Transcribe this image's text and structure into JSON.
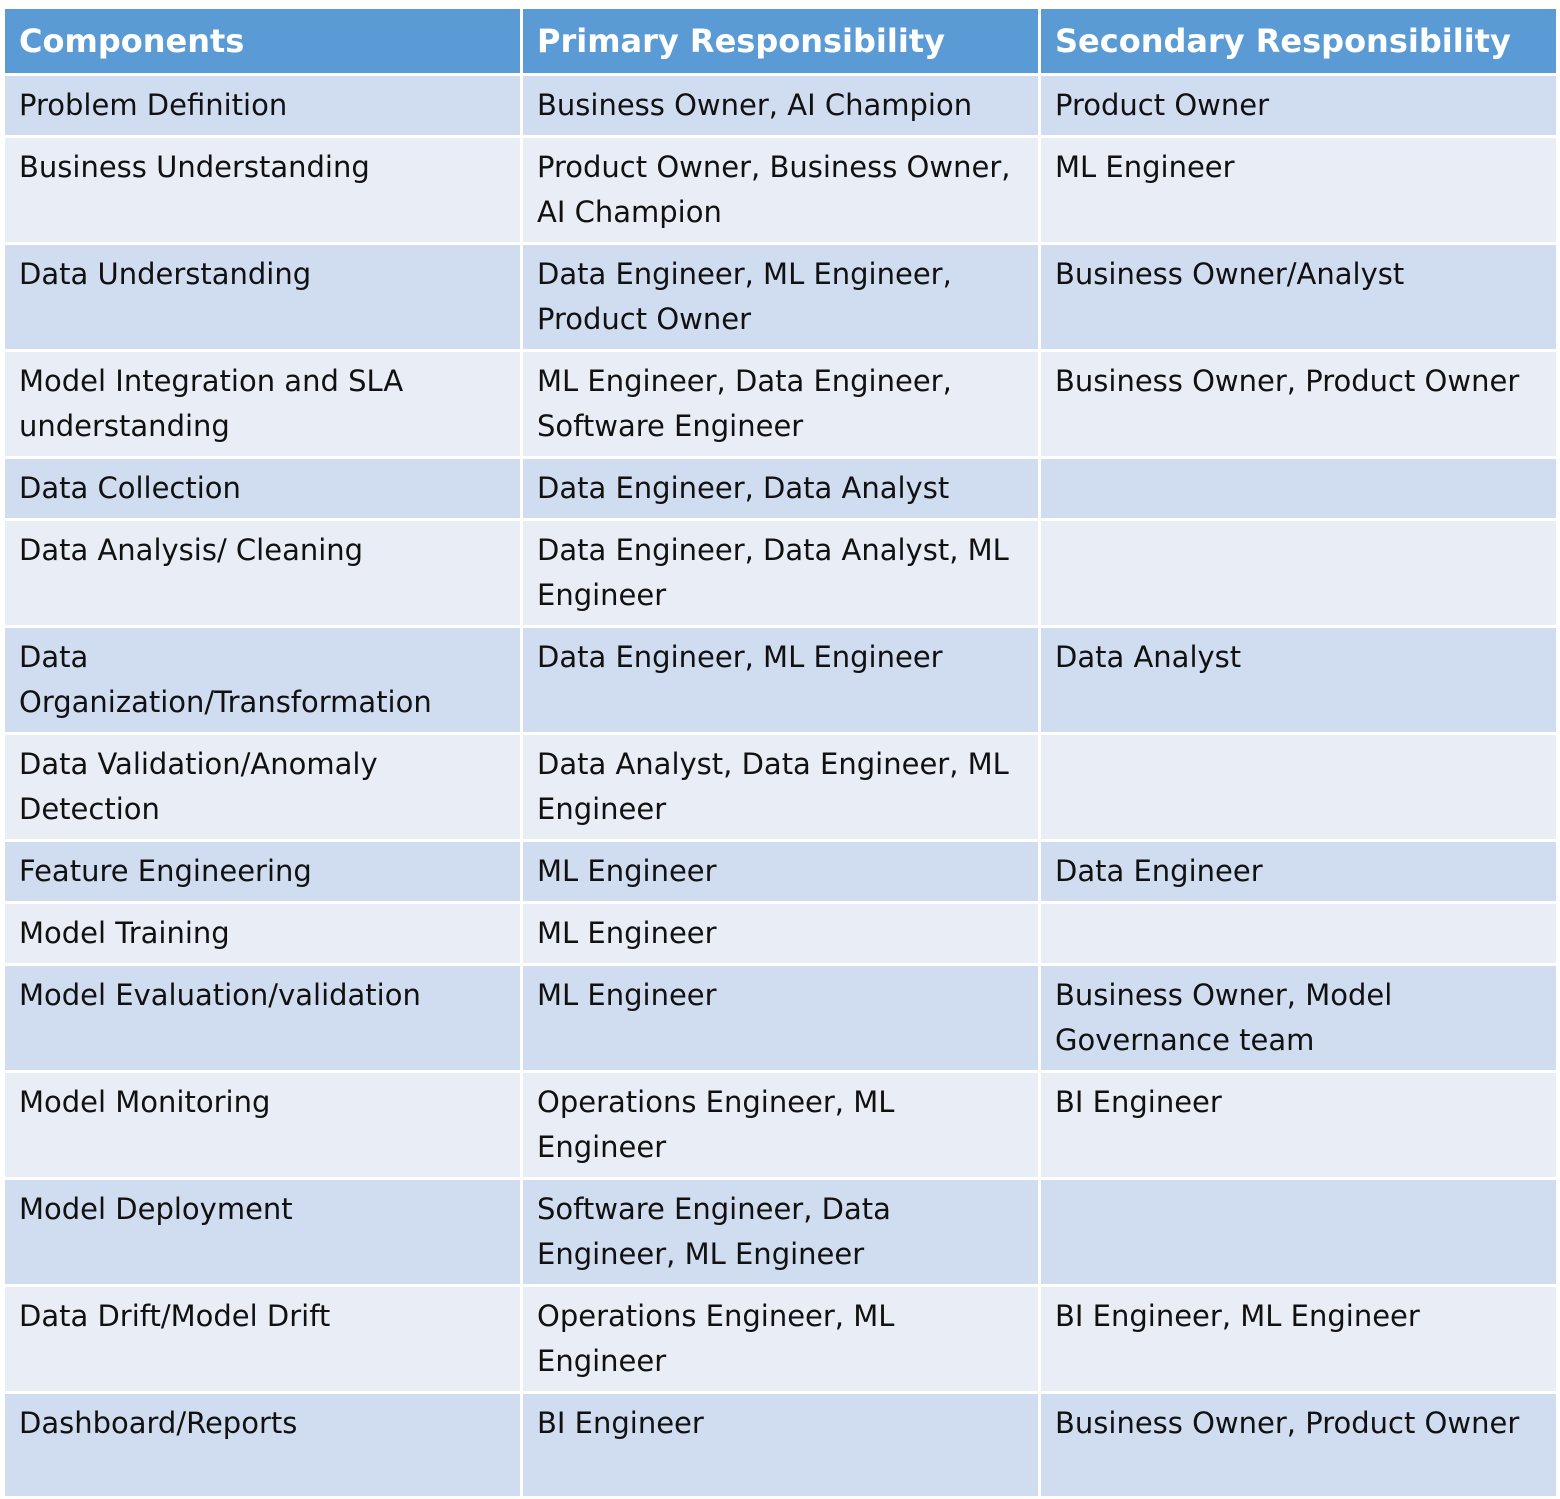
{
  "header": {
    "col1": "Components",
    "col2": "Primary Responsibility",
    "col3": "Secondary Responsibility"
  },
  "rows": [
    {
      "component": "Problem Definition",
      "primary": "Business Owner, AI Champion",
      "secondary": "Product Owner"
    },
    {
      "component": "Business Understanding",
      "primary": "Product Owner, Business Owner, AI Champion",
      "secondary": "ML Engineer"
    },
    {
      "component": "Data Understanding",
      "primary": "Data Engineer, ML Engineer, Product Owner",
      "secondary": "Business Owner/Analyst"
    },
    {
      "component": "Model Integration and SLA understanding",
      "primary": "ML Engineer, Data Engineer, Software Engineer",
      "secondary": "Business Owner, Product Owner"
    },
    {
      "component": "Data Collection",
      "primary": "Data Engineer, Data Analyst",
      "secondary": ""
    },
    {
      "component": "Data Analysis/ Cleaning",
      "primary": "Data Engineer, Data Analyst, ML Engineer",
      "secondary": ""
    },
    {
      "component": "Data Organization/Transformation",
      "primary": "Data Engineer, ML Engineer",
      "secondary": "Data Analyst"
    },
    {
      "component": "Data Validation/Anomaly Detection",
      "primary": "Data Analyst, Data Engineer, ML Engineer",
      "secondary": ""
    },
    {
      "component": "Feature Engineering",
      "primary": "ML Engineer",
      "secondary": "Data Engineer"
    },
    {
      "component": "Model Training",
      "primary": "ML Engineer",
      "secondary": ""
    },
    {
      "component": "Model Evaluation/validation",
      "primary": "ML Engineer",
      "secondary": "Business Owner, Model Governance team"
    },
    {
      "component": "Model Monitoring",
      "primary": "Operations Engineer, ML Engineer",
      "secondary": "BI Engineer"
    },
    {
      "component": "Model Deployment",
      "primary": "Software Engineer, Data Engineer, ML Engineer",
      "secondary": ""
    },
    {
      "component": "Data Drift/Model Drift",
      "primary": "Operations Engineer, ML Engineer",
      "secondary": "BI Engineer, ML Engineer"
    },
    {
      "component": "Dashboard/Reports",
      "primary": "BI Engineer",
      "secondary": "Business Owner, Product Owner"
    }
  ]
}
